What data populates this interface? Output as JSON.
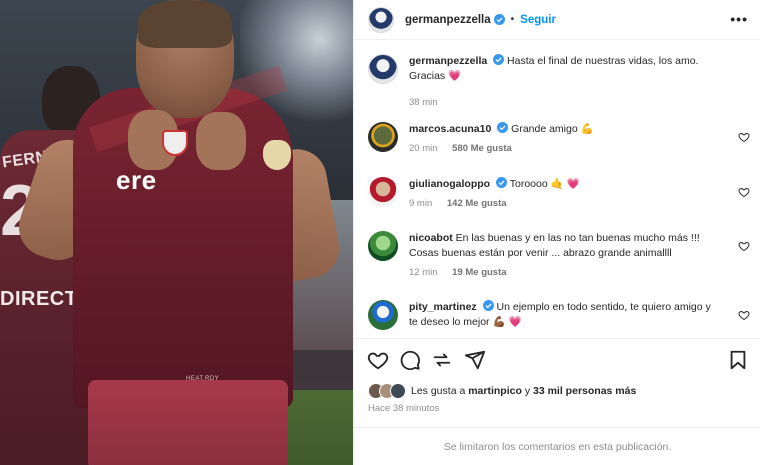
{
  "post": {
    "username": "germanpezzella",
    "follow_label": "Seguir",
    "separator": "•",
    "more_label": "•••"
  },
  "photo": {
    "bg_player_name": "FERNANDO",
    "bg_player_number": "20",
    "bg_sponsor": "DIRECTV",
    "main_sponsor": "ere",
    "main_small": "HEAT.RDY"
  },
  "caption": {
    "username": "germanpezzella",
    "text_line1": "Hasta el final de nuestras vidas, los amo.",
    "text_line2": "Gracias",
    "emoji": "💗",
    "time": "38 min"
  },
  "comments": [
    {
      "username": "marcos.acuna10",
      "text": "Grande amigo 💪",
      "time": "20 min",
      "likes": "580 Me gusta"
    },
    {
      "username": "giulianogaloppo",
      "text": "Toroooo 🤙 💗",
      "time": "9 min",
      "likes": "142 Me gusta"
    },
    {
      "username": "nicoabot",
      "text": "En las buenas y en las no tan buenas mucho más !!! Cosas buenas están por venir ... abrazo grande animallll",
      "time": "12 min",
      "likes": "19 Me gusta"
    },
    {
      "username": "pity_martinez",
      "text": "Un ejemplo en todo sentido, te quiero amigo y te deseo lo mejor 💪🏾 💗",
      "time": "",
      "likes": ""
    }
  ],
  "likes_summary": {
    "prefix": "Les gusta a",
    "user": "martinpico",
    "middle": "y",
    "count": "33 mil personas más"
  },
  "timestamp": "Hace 38 minutos",
  "footer_text": "Se limitaron los comentarios en esta publicación.",
  "colors": {
    "accent": "#0095f6",
    "verified": "#3897f0",
    "muted": "#8e8e8e"
  },
  "icons": [
    "heart-icon",
    "comment-icon",
    "share-icon",
    "send-icon",
    "bookmark-icon",
    "verified-icon",
    "more-icon"
  ]
}
